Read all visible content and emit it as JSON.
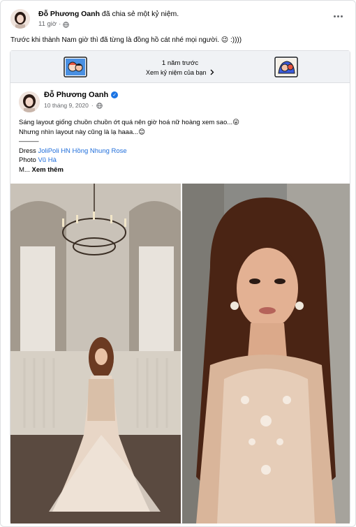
{
  "post": {
    "author": "Đỗ Phương Oanh",
    "action": "đã chia sẻ một kỷ niệm.",
    "time": "11 giờ",
    "caption": "Trước khi thành Nam giờ thì đã từng là đồng hồ cát nhé mọi người. 😉 :))))"
  },
  "memory": {
    "title": "1 năm trước",
    "link": "Xem kỷ niệm của bạn"
  },
  "inner_post": {
    "author": "Đỗ Phương Oanh",
    "date": "10 tháng 9, 2020",
    "line1": "Sáng layout giống chuồn chuồn ớt quá nên giờ hoá nữ hoàng xem sao...😜",
    "line2": "Nhưng nhìn layout này cũng là lạ haaa...😊",
    "line3": "———",
    "dress_label": "Dress",
    "dress_link": "JoliPoli HN Hồng Nhung Rose",
    "photo_label": "Photo",
    "photo_link": "Vũ Hà",
    "more_prefix": "M...",
    "see_more": "Xem thêm"
  },
  "colors": {
    "link": "#216fdb",
    "verified": "#1b74e4",
    "meta": "#65676b"
  },
  "icons": [
    "globe-icon",
    "more-icon",
    "verified-icon",
    "chevron-right-icon"
  ]
}
